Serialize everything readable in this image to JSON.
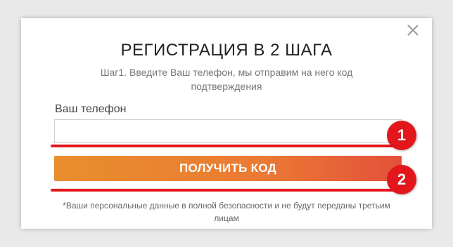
{
  "modal": {
    "title": "РЕГИСТРАЦИЯ В 2 ШАГА",
    "subtitle": "Шаг1. Введите Ваш телефон, мы отправим на него код подтверждения",
    "phone_label": "Ваш телефон",
    "phone_value": "",
    "phone_placeholder": "",
    "submit_label": "ПОЛУЧИТЬ КОД",
    "privacy_note": "*Ваши персональные данные в полной безопасности и не будут переданы третьим лицам"
  },
  "annotations": {
    "badge_1": "1",
    "badge_2": "2"
  },
  "icons": {
    "close": "close-icon"
  },
  "colors": {
    "button_start": "#e98e2d",
    "button_end": "#e4503a",
    "annotation_red": "#e3161b"
  }
}
